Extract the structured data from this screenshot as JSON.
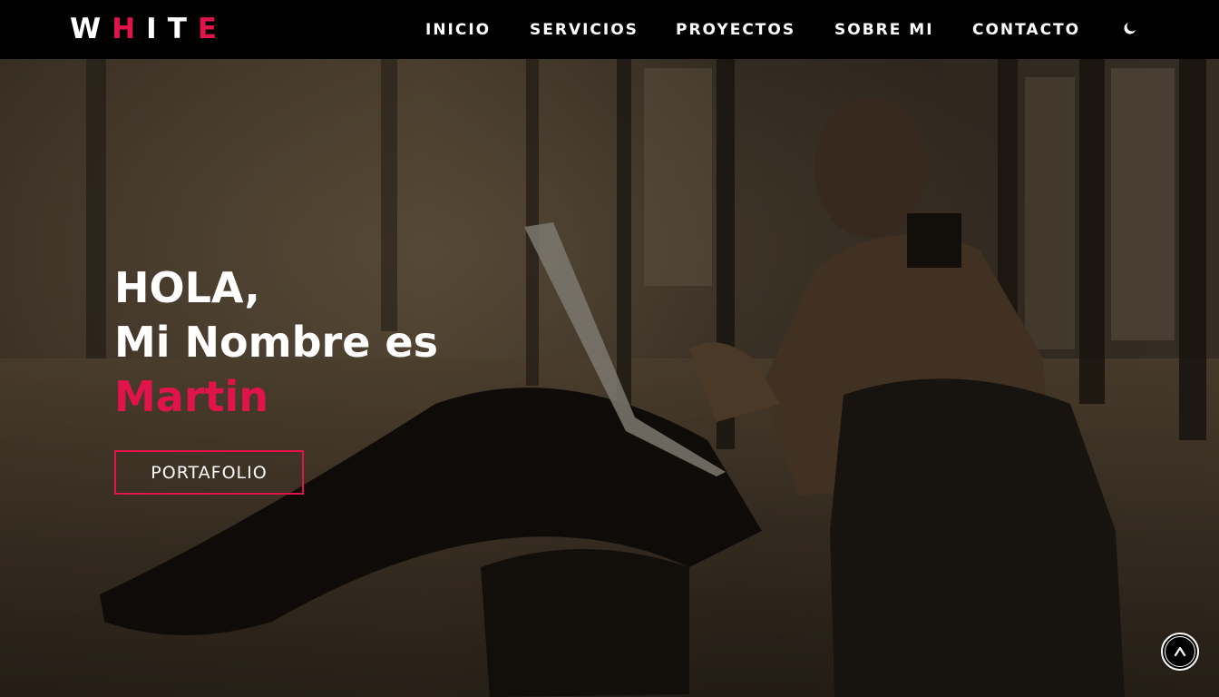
{
  "brand": {
    "letters": [
      "W",
      "H",
      "I",
      "T",
      "E"
    ],
    "letter_colors": [
      "#ffffff",
      "#e0144a",
      "#ffffff",
      "#ffffff",
      "#e0144a"
    ]
  },
  "nav": {
    "items": [
      {
        "label": "INICIO"
      },
      {
        "label": "SERVICIOS"
      },
      {
        "label": "PROYECTOS"
      },
      {
        "label": "SOBRE MI"
      },
      {
        "label": "CONTACTO"
      }
    ],
    "theme_icon": "moon-icon"
  },
  "hero": {
    "greeting": "HOLA,",
    "intro": "Mi Nombre es",
    "name": "Martin",
    "button_label": "PORTAFOLIO"
  },
  "scroll_top": {
    "label": "^",
    "icon": "chevron-up-icon"
  },
  "colors": {
    "accent": "#e0144a",
    "navbar_bg": "#000000",
    "text": "#ffffff"
  }
}
